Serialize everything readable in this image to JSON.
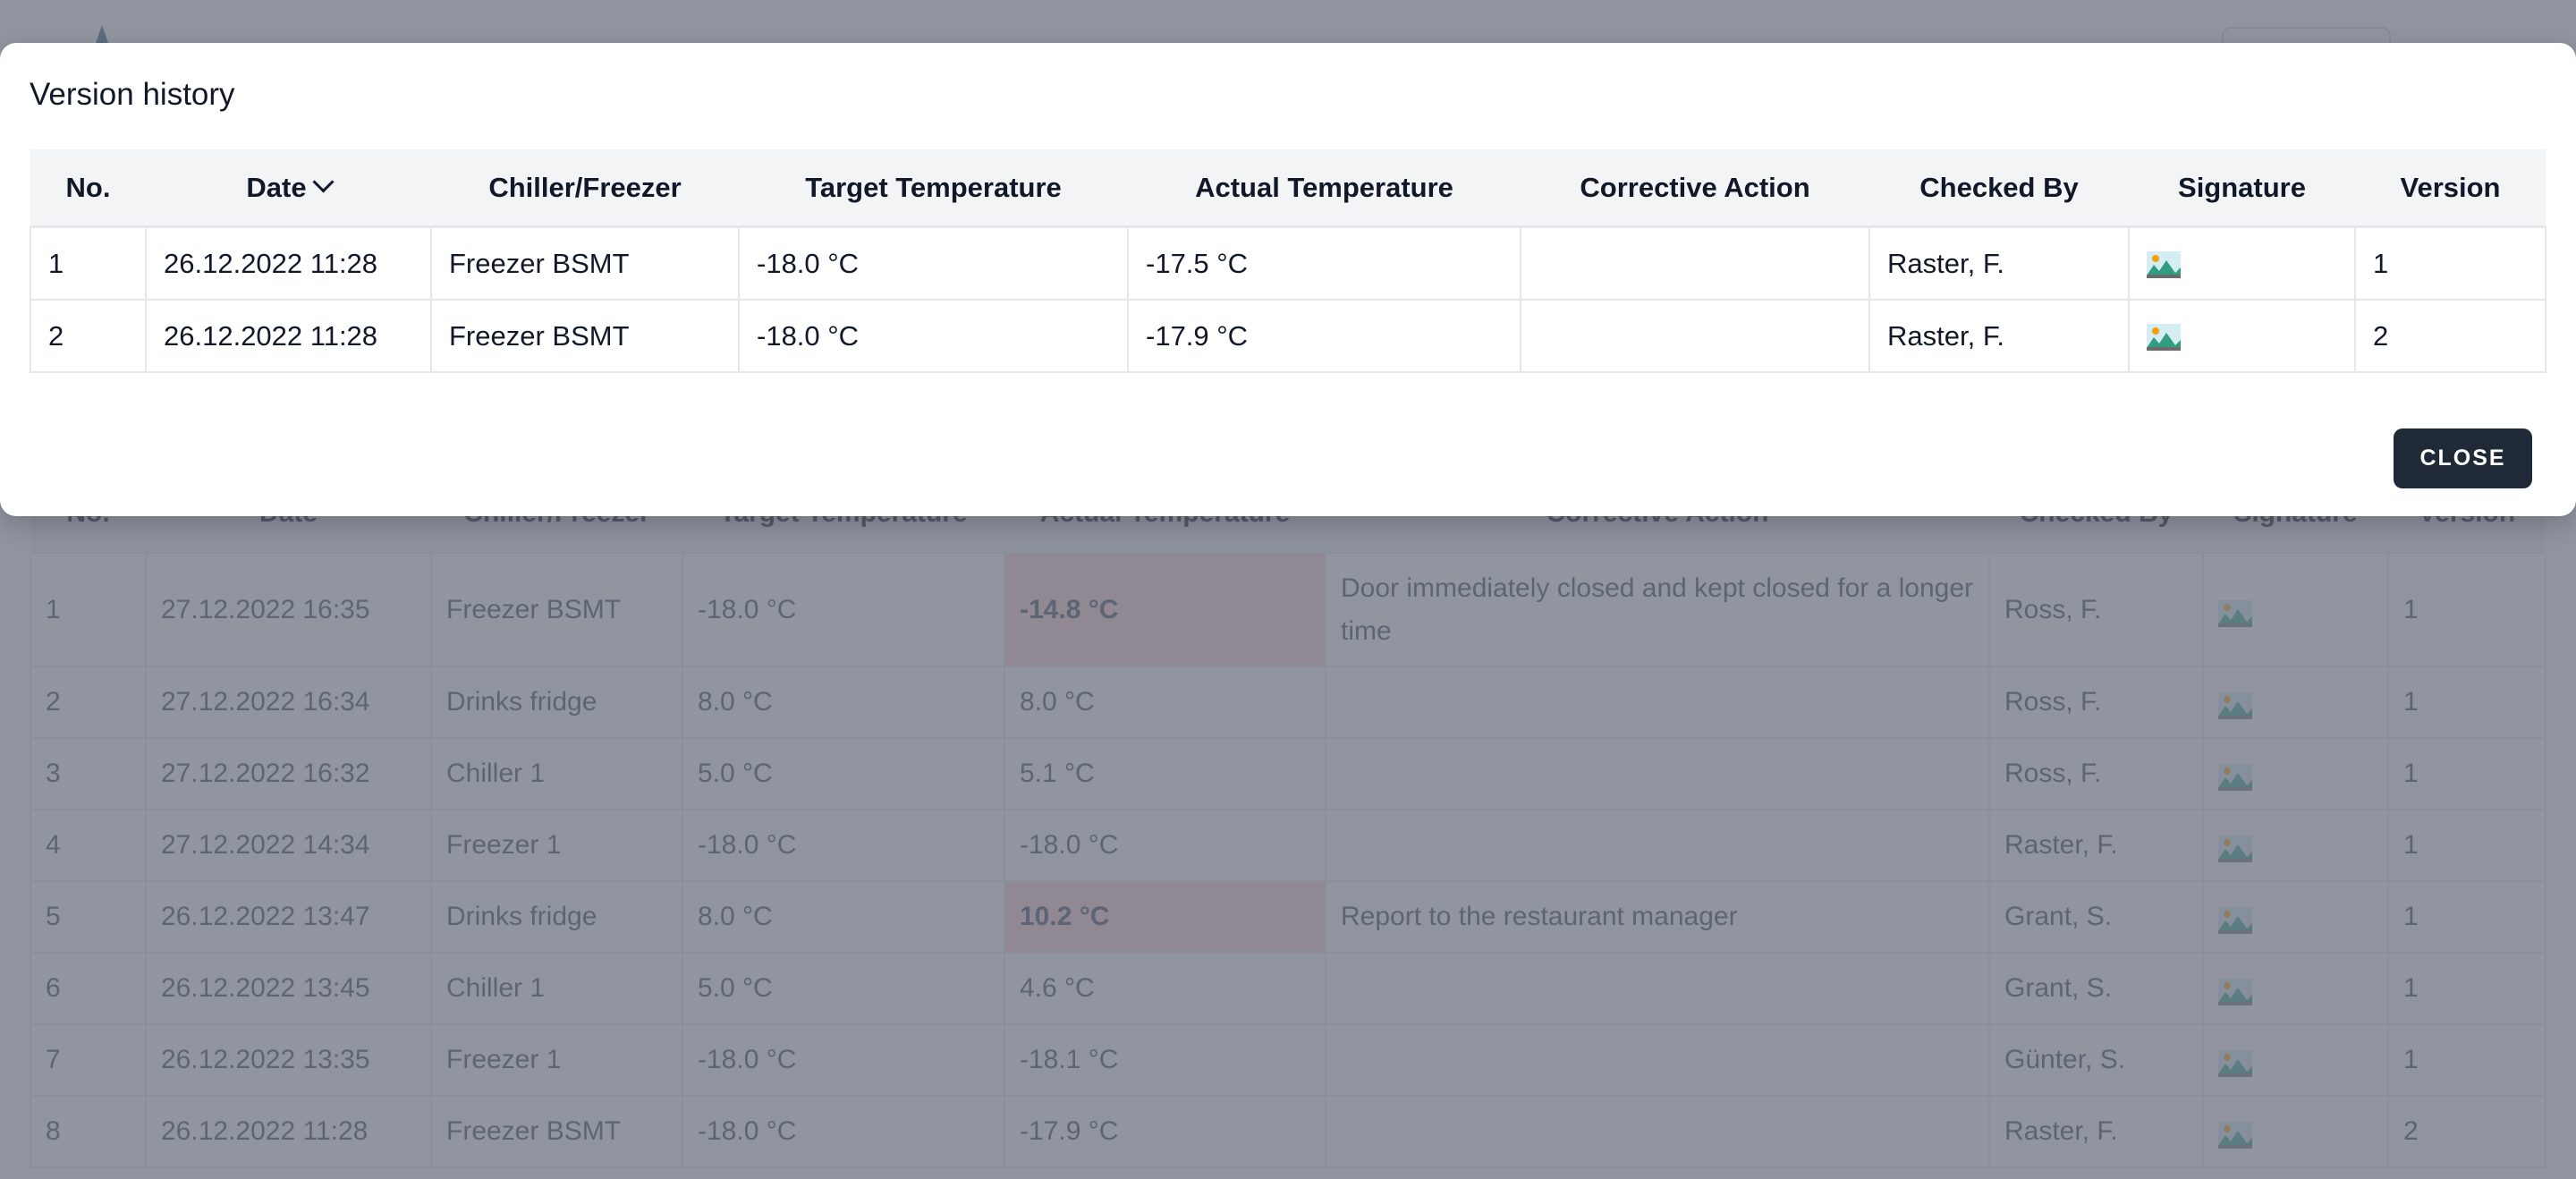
{
  "modal": {
    "title": "Version history",
    "close_label": "CLOSE",
    "columns": [
      "No.",
      "Date",
      "Chiller/Freezer",
      "Target Temperature",
      "Actual Temperature",
      "Corrective Action",
      "Checked By",
      "Signature",
      "Version"
    ],
    "sort_column": "Date",
    "sort_direction": "descending",
    "rows": [
      {
        "no": "1",
        "date": "26.12.2022 11:28",
        "unit": "Freezer BSMT",
        "target": "-18.0 °C",
        "actual": "-17.5 °C",
        "action": "",
        "checked_by": "Raster, F.",
        "signature": "image-icon",
        "version": "1"
      },
      {
        "no": "2",
        "date": "26.12.2022 11:28",
        "unit": "Freezer BSMT",
        "target": "-18.0 °C",
        "actual": "-17.9 °C",
        "action": "",
        "checked_by": "Raster, F.",
        "signature": "image-icon",
        "version": "2"
      }
    ]
  },
  "background": {
    "columns": [
      "No.",
      "Date",
      "Chiller/Freezer",
      "Target Temperature",
      "Actual Temperature",
      "Corrective Action",
      "Checked By",
      "Signature",
      "Version"
    ],
    "rows": [
      {
        "no": "1",
        "date": "27.12.2022 16:35",
        "unit": "Freezer BSMT",
        "target": "-18.0 °C",
        "actual": "-14.8 °C",
        "alert": true,
        "action": "Door immediately closed and kept closed for a longer time",
        "checked_by": "Ross, F.",
        "version": "1"
      },
      {
        "no": "2",
        "date": "27.12.2022 16:34",
        "unit": "Drinks fridge",
        "target": "8.0 °C",
        "actual": "8.0 °C",
        "alert": false,
        "action": "",
        "checked_by": "Ross, F.",
        "version": "1"
      },
      {
        "no": "3",
        "date": "27.12.2022 16:32",
        "unit": "Chiller 1",
        "target": "5.0 °C",
        "actual": "5.1 °C",
        "alert": false,
        "action": "",
        "checked_by": "Ross, F.",
        "version": "1"
      },
      {
        "no": "4",
        "date": "27.12.2022 14:34",
        "unit": "Freezer 1",
        "target": "-18.0 °C",
        "actual": "-18.0 °C",
        "alert": false,
        "action": "",
        "checked_by": "Raster, F.",
        "version": "1"
      },
      {
        "no": "5",
        "date": "26.12.2022 13:47",
        "unit": "Drinks fridge",
        "target": "8.0 °C",
        "actual": "10.2 °C",
        "alert": true,
        "action": "Report to the restaurant manager",
        "checked_by": "Grant, S.",
        "version": "1"
      },
      {
        "no": "6",
        "date": "26.12.2022 13:45",
        "unit": "Chiller 1",
        "target": "5.0 °C",
        "actual": "4.6 °C",
        "alert": false,
        "action": "",
        "checked_by": "Grant, S.",
        "version": "1"
      },
      {
        "no": "7",
        "date": "26.12.2022 13:35",
        "unit": "Freezer 1",
        "target": "-18.0 °C",
        "actual": "-18.1 °C",
        "alert": false,
        "action": "",
        "checked_by": "Günter, S.",
        "version": "1"
      },
      {
        "no": "8",
        "date": "26.12.2022 11:28",
        "unit": "Freezer BSMT",
        "target": "-18.0 °C",
        "actual": "-17.9 °C",
        "alert": false,
        "action": "",
        "checked_by": "Raster, F.",
        "version": "2"
      }
    ]
  },
  "colors": {
    "alert_cell": "#fecaca",
    "close_button": "#1f2937",
    "overlay": "#6b7280"
  }
}
